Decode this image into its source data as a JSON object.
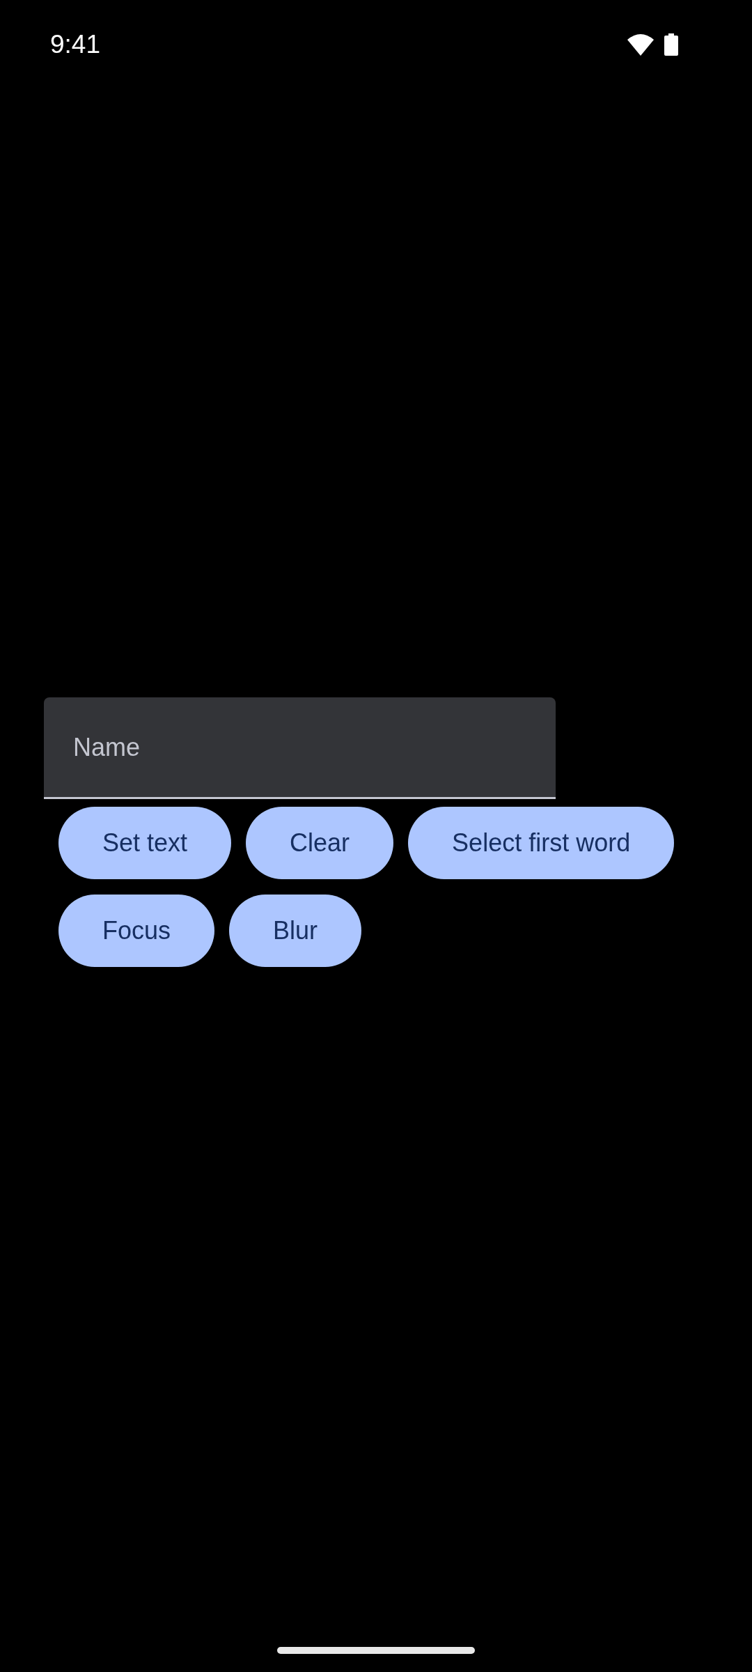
{
  "status_bar": {
    "time": "9:41"
  },
  "text_field": {
    "placeholder": "Name"
  },
  "buttons": [
    {
      "label": "Set text"
    },
    {
      "label": "Clear"
    },
    {
      "label": "Select first word"
    },
    {
      "label": "Focus"
    },
    {
      "label": "Blur"
    }
  ]
}
